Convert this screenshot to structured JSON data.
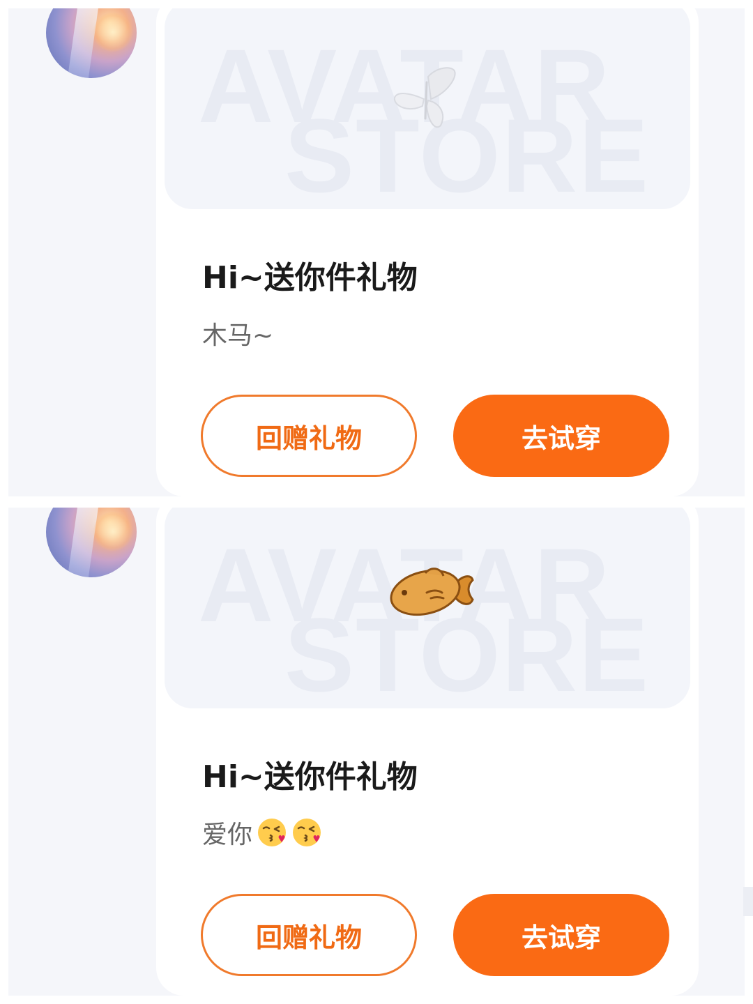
{
  "colors": {
    "accent": "#fa6a14",
    "accent_outline": "#f07a2c",
    "background": "#f5f6fa",
    "card": "#ffffff",
    "title_text": "#1a1a1a",
    "message_text": "#666666"
  },
  "gift_cards": [
    {
      "watermark_line1": "AVATAR",
      "watermark_line2": "STORE",
      "item_icon": "butterfly-icon",
      "title": "Hi~送你件礼物",
      "message": "木马~",
      "message_emojis": [],
      "return_gift_label": "回赠礼物",
      "try_on_label": "去试穿"
    },
    {
      "watermark_line1": "AVATAR",
      "watermark_line2": "STORE",
      "item_icon": "fish-icon",
      "title": "Hi~送你件礼物",
      "message": "爱你",
      "message_emojis": [
        "kissing-face-emoji",
        "kissing-face-emoji"
      ],
      "return_gift_label": "回赠礼物",
      "try_on_label": "去试穿"
    }
  ]
}
